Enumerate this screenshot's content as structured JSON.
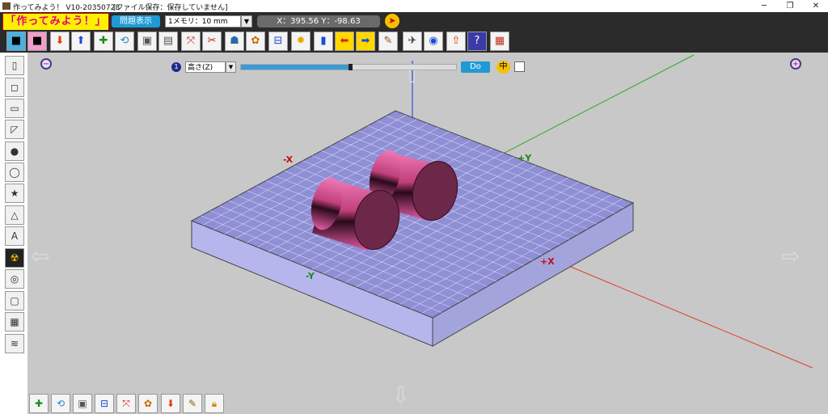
{
  "window": {
    "title": "作ってみよう！ V10-20350728",
    "document_status": "[ファイル保存：保存していません]",
    "controls": {
      "minimize": "─",
      "restore": "❐",
      "close": "✕"
    }
  },
  "toolbar": {
    "logo": "「作ってみよう！」",
    "mondai_button": "問題表示",
    "memori_value": "1メモリ：10 mm",
    "coords": "X：395.56  Y：-98.63",
    "main_icons": [
      "cube-blue-icon",
      "cube-pink-icon",
      "import-icon",
      "export-icon",
      "add-shape-icon",
      "rotate-icon",
      "section-icon",
      "solid-icon",
      "scale-icon",
      "cut-icon",
      "robot-icon",
      "palette-icon",
      "measure-icon",
      "gear-icon",
      "book-icon",
      "arrow-left-icon",
      "arrow-right-icon",
      "brush-icon",
      "walk-icon",
      "camera-icon",
      "upload-icon",
      "help-icon",
      "calculator-icon"
    ]
  },
  "sidebar": {
    "items": [
      "cylinder-icon",
      "cube-icon",
      "rect-prism-icon",
      "wedge-icon",
      "sphere-icon",
      "cylinder-short-icon",
      "star-icon",
      "cone-icon",
      "letter-a-icon",
      "hazard-icon",
      "disc-icon",
      "box-icon",
      "stack-icon",
      "spring-icon"
    ]
  },
  "height_control": {
    "badge": "1",
    "axis_select": "高さ(Z)",
    "slider_value": 0.5,
    "do_label": "Do",
    "naka_label": "中"
  },
  "scene": {
    "axis_labels": {
      "x_neg": "-X",
      "x_pos": "+X",
      "y_neg": "-Y",
      "y_pos": "+Y"
    },
    "axis_colors": {
      "x": "#e33b2b",
      "y": "#2ea82e",
      "z": "#1a2fd6"
    },
    "plate_color": "#8f8fd6",
    "cylinder_color": "#e25aa4"
  },
  "bottom_bar": {
    "items": [
      "add-shape-icon",
      "rotate-icon",
      "section-icon",
      "measure-icon",
      "scale-icon",
      "palette-icon",
      "export-icon",
      "brush-icon",
      "lock-icon"
    ]
  }
}
